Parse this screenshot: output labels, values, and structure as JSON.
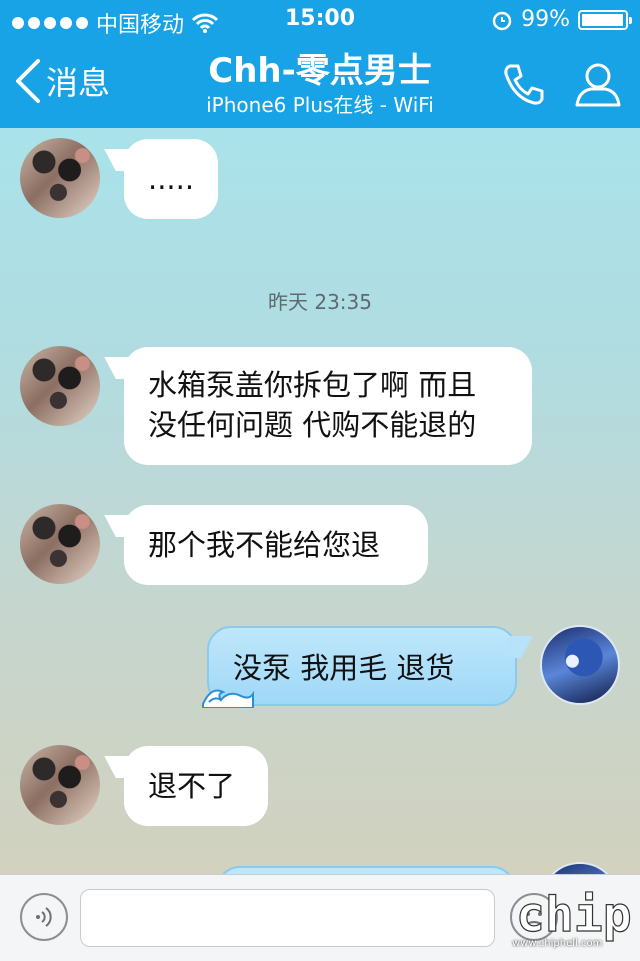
{
  "status_bar": {
    "carrier": "中国移动",
    "time": "15:00",
    "battery": "99%",
    "signal_dots": 5
  },
  "header": {
    "back_label": "消息",
    "title": "Chh-零点男士",
    "subtitle": "iPhone6 Plus在线 - WiFi",
    "accent_color": "#17a3e6"
  },
  "messages": [
    {
      "side": "left",
      "text": "....."
    },
    {
      "side": "left",
      "text_line1": "水箱泵盖你拆包了啊 而且",
      "text_line2": "没任何问题 代购不能退的"
    },
    {
      "side": "left",
      "text": "那个我不能给您退"
    },
    {
      "side": "right",
      "text": "没泵  我用毛  退货"
    },
    {
      "side": "left",
      "text": "退不了"
    }
  ],
  "timestamp": "昨天 23:35",
  "input_bar": {
    "placeholder": ""
  },
  "watermark": {
    "logo": "chiphell",
    "url": "www.chiphell.com"
  },
  "icons": [
    "wifi-icon",
    "alarm-icon",
    "battery-icon",
    "back-chevron-icon",
    "phone-icon",
    "contact-icon",
    "voice-icon",
    "emoji-icon",
    "wave-icon"
  ]
}
